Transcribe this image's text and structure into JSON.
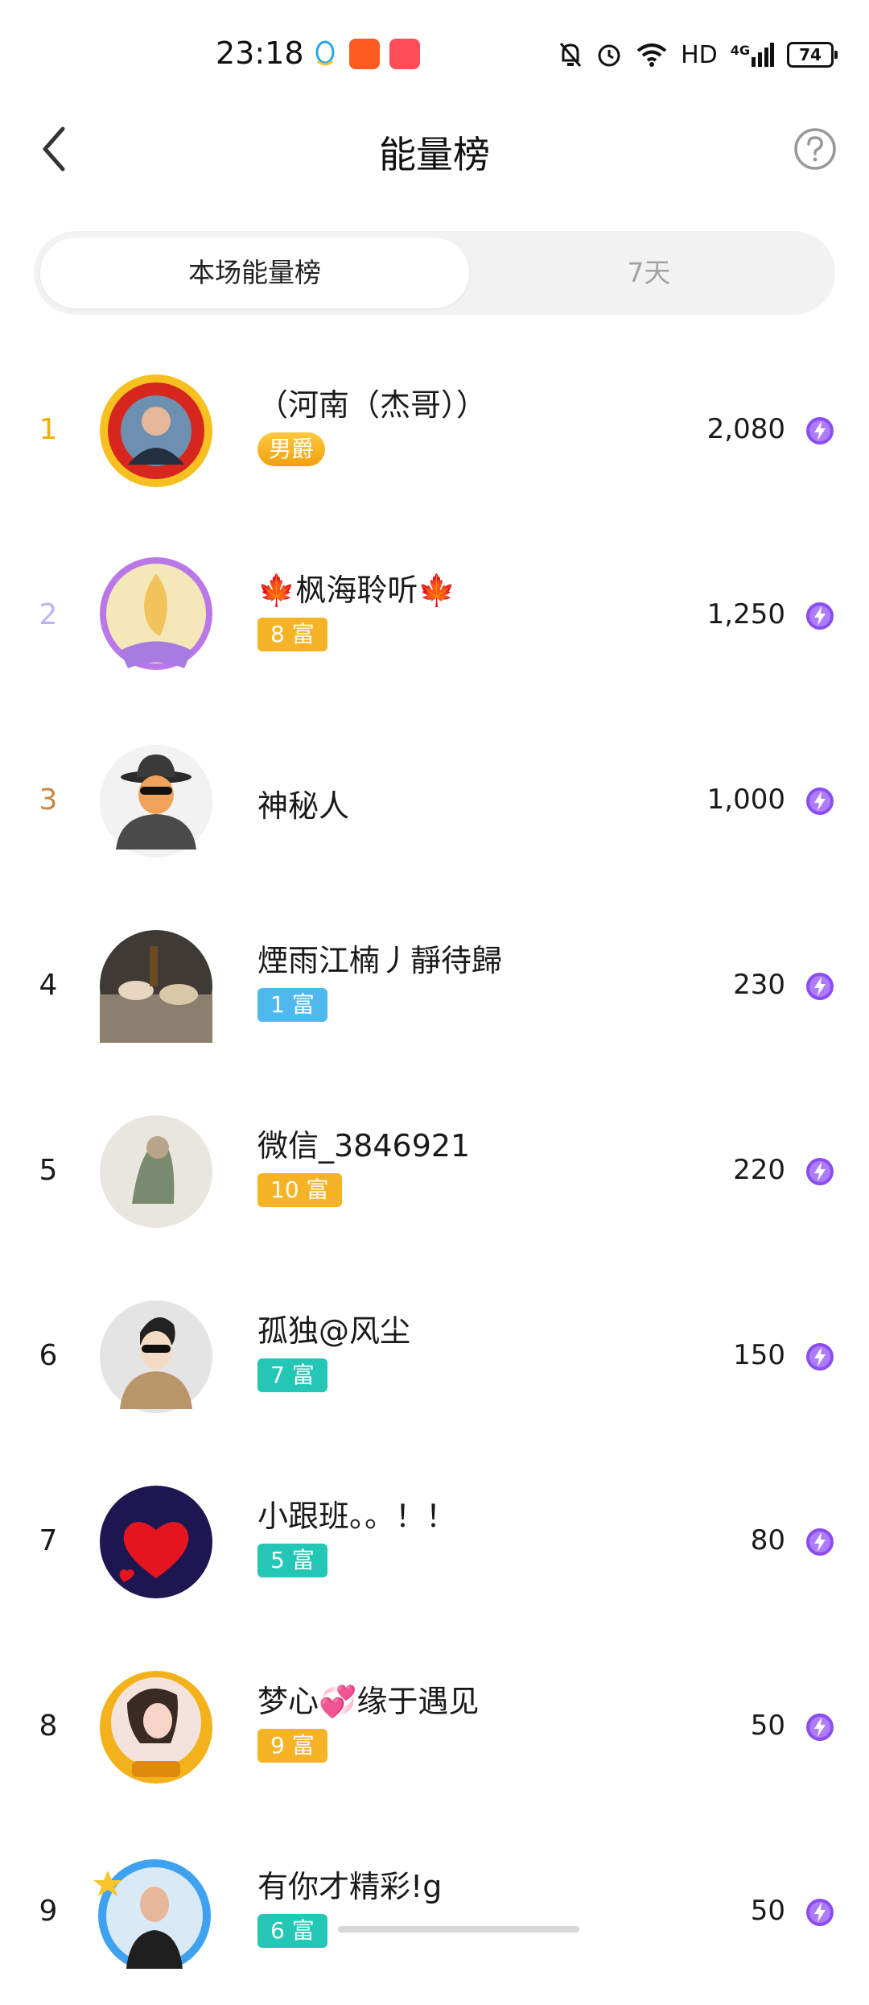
{
  "status_bar": {
    "time": "23:18",
    "hd": "HD",
    "network": "4G",
    "battery": "74"
  },
  "header": {
    "title": "能量榜"
  },
  "tabs": [
    {
      "label": "本场能量榜",
      "active": true
    },
    {
      "label": "7天",
      "active": false
    }
  ],
  "colors": {
    "rank1": "#f0b000",
    "rank2": "#b7b6f0",
    "rank3": "#c8873e",
    "rank_default": "#1a1a1a",
    "badge_gold": "#f6b325",
    "badge_blue": "#4fb9ef",
    "badge_teal": "#24c6b5",
    "energy": "#8a4df0"
  },
  "entries": [
    {
      "rank": "1",
      "name": "（河南（杰哥））",
      "badge": "男爵",
      "score": "2,080"
    },
    {
      "rank": "2",
      "name": "🍁枫海聆听🍁",
      "badge": "8 富",
      "score": "1,250"
    },
    {
      "rank": "3",
      "name": "神秘人",
      "badge": "",
      "score": "1,000"
    },
    {
      "rank": "4",
      "name": "煙雨江楠丿靜待歸",
      "badge": "1 富",
      "score": "230"
    },
    {
      "rank": "5",
      "name": "微信_3846921",
      "badge": "10 富",
      "score": "220"
    },
    {
      "rank": "6",
      "name": "孤独@风尘",
      "badge": "7 富",
      "score": "150"
    },
    {
      "rank": "7",
      "name": "小跟班。。！！",
      "badge": "5 富",
      "score": "80"
    },
    {
      "rank": "8",
      "name": "梦心💞缘于遇见",
      "badge": "9 富",
      "score": "50"
    },
    {
      "rank": "9",
      "name": "有你才精彩!g",
      "badge": "6 富",
      "score": "50"
    }
  ]
}
